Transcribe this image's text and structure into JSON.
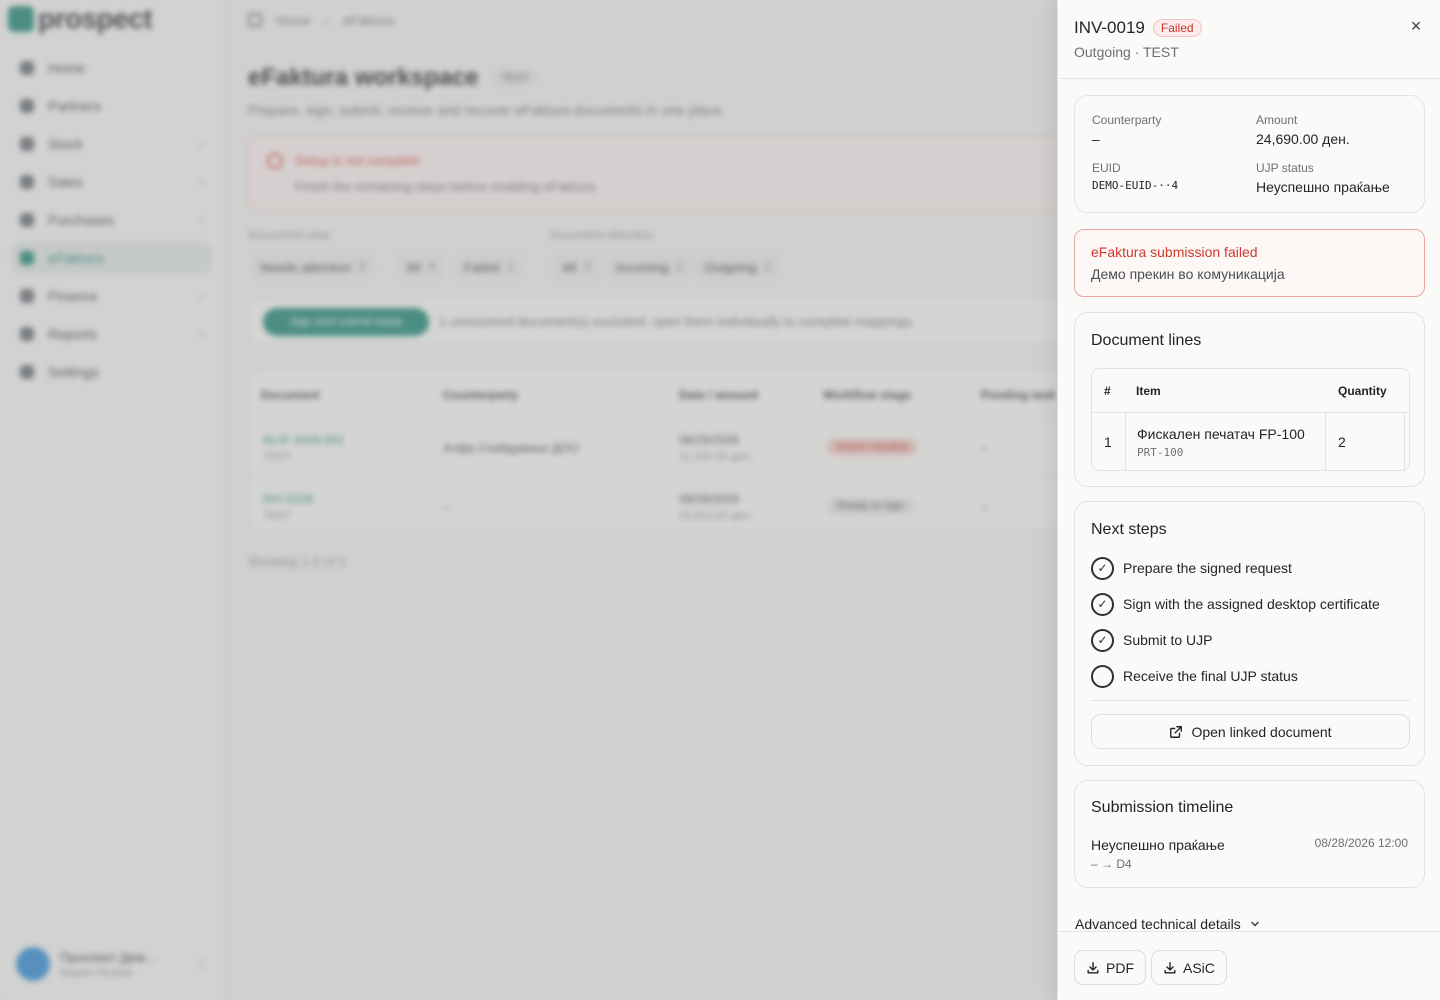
{
  "background": {
    "brand_name": "prospect",
    "breadcrumb": [
      "Home",
      "eFaktura"
    ],
    "nav": [
      {
        "label": "Home",
        "chevron": false,
        "active": false
      },
      {
        "label": "Partners",
        "chevron": false,
        "active": false
      },
      {
        "label": "Stock",
        "chevron": true,
        "active": false
      },
      {
        "label": "Sales",
        "chevron": true,
        "active": false
      },
      {
        "label": "Purchases",
        "chevron": true,
        "active": false
      },
      {
        "label": "eFaktura",
        "chevron": false,
        "active": true
      },
      {
        "label": "Finance",
        "chevron": true,
        "active": false
      },
      {
        "label": "Reports",
        "chevron": true,
        "active": false
      },
      {
        "label": "Settings",
        "chevron": false,
        "active": false
      }
    ],
    "user_name": "Проспект Дем...",
    "user_sub": "Марко Петров",
    "page_title": "eFaktura workspace",
    "page_badge": "TEST",
    "page_subtitle": "Prepare, sign, submit, receive and recover eFaktura documents in one place.",
    "setup_alert_title": "Setup is not complete",
    "setup_alert_text": "Finish the remaining steps before enabling eFaktura.",
    "filter_view_label": "Document view",
    "filter_direction_label": "Document direction",
    "view_chips": [
      {
        "label": "Needs attention",
        "count": "2"
      },
      {
        "label": "All",
        "count": "4"
      },
      {
        "label": "Failed",
        "count": "1"
      }
    ],
    "direction_chips": [
      {
        "label": "All",
        "count": "2"
      },
      {
        "label": "Incoming",
        "count": "1"
      },
      {
        "label": "Outgoing",
        "count": "1"
      }
    ],
    "bulk_button": "Sign next submit-ready",
    "bulk_text": "1 unresolved document(s) excluded: open them individually to complete mappings.",
    "table_headers": [
      "Document",
      "Counterparty",
      "Date / amount",
      "Workflow stage",
      "Pending task"
    ],
    "rows": [
      {
        "doc": "IN-IF-2026-001",
        "doc_sub": "TEST",
        "party": "Алфа Снабдување ДОО",
        "date": "08/29/2026",
        "amount": "12,240.00 ден.",
        "stage": "Action needed",
        "stage_kind": "error",
        "pending": "–"
      },
      {
        "doc": "INV-0109",
        "doc_sub": "TEST",
        "party": "–",
        "date": "08/28/2026",
        "amount": "29,910.00 ден.",
        "stage": "Ready to sign",
        "stage_kind": "ready",
        "pending": "–"
      }
    ],
    "showing": "Showing 1-2 of 2"
  },
  "drawer": {
    "title": "INV-0019",
    "status": "Failed",
    "subtitle": "Outgoing · TEST",
    "close_symbol": "×",
    "summary": {
      "counterparty_label": "Counterparty",
      "counterparty_value": "–",
      "amount_label": "Amount",
      "amount_value": "24,690.00 ден.",
      "euid_label": "EUID",
      "euid_value": "DEMO-EUID-··4",
      "ujp_label": "UJP status",
      "ujp_value": "Неуспешно праќање"
    },
    "error": {
      "title": "eFaktura submission failed",
      "text": "Демо прекин во комуникација"
    },
    "lines": {
      "title": "Document lines",
      "headers": {
        "num": "#",
        "item": "Item",
        "qty": "Quantity"
      },
      "rows": [
        {
          "num": "1",
          "item": "Фискален печатач FP-100",
          "code": "PRT-100",
          "qty": "2"
        }
      ]
    },
    "steps": {
      "title": "Next steps",
      "items": [
        {
          "label": "Prepare the signed request",
          "done": true
        },
        {
          "label": "Sign with the assigned desktop certificate",
          "done": true
        },
        {
          "label": "Submit to UJP",
          "done": true
        },
        {
          "label": "Receive the final UJP status",
          "done": false
        }
      ],
      "open_button": "Open linked document",
      "check_symbol": "✓"
    },
    "timeline": {
      "title": "Submission timeline",
      "event": "Неуспешно праќање",
      "date": "08/28/2026 12:00",
      "transition": "– → D4"
    },
    "advanced_label": "Advanced technical details",
    "footer": {
      "pdf": "PDF",
      "asic": "ASiC"
    }
  },
  "colors": {
    "accent": "#1f8a78",
    "error": "#d0392e",
    "error_border": "#eaa6a0"
  }
}
